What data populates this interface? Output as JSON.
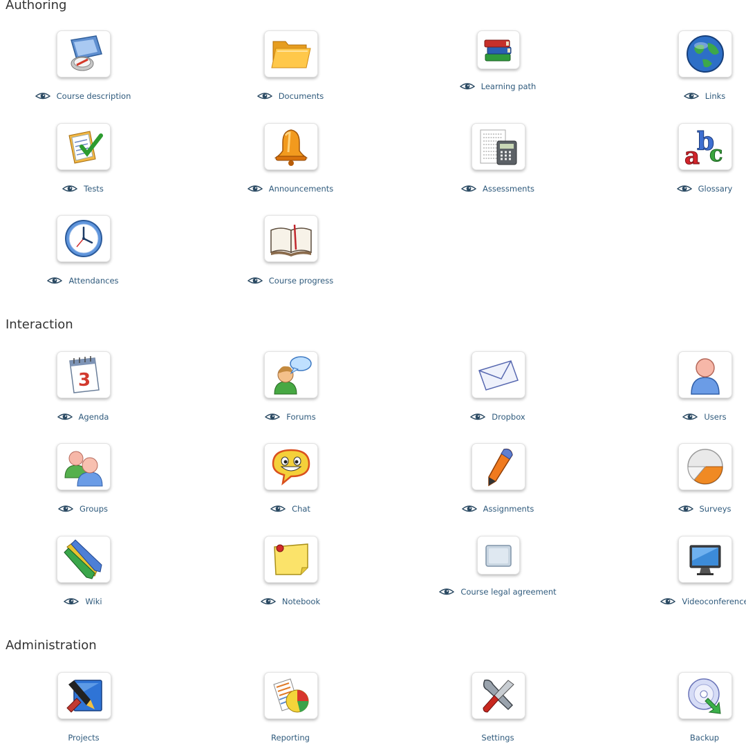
{
  "sections": {
    "authoring": {
      "title": "Authoring"
    },
    "interaction": {
      "title": "Interaction"
    },
    "administration": {
      "title": "Administration"
    }
  },
  "tools": {
    "course_description": {
      "label": "Course description",
      "icon": "compass-map-icon",
      "visible": true
    },
    "documents": {
      "label": "Documents",
      "icon": "folder-icon",
      "visible": true
    },
    "learning_path": {
      "label": "Learning path",
      "icon": "books-icon",
      "visible": true
    },
    "links": {
      "label": "Links",
      "icon": "globe-icon",
      "visible": true
    },
    "tests": {
      "label": "Tests",
      "icon": "checklist-icon",
      "visible": true
    },
    "announcements": {
      "label": "Announcements",
      "icon": "bell-icon",
      "visible": true
    },
    "assessments": {
      "label": "Assessments",
      "icon": "calculator-icon",
      "visible": true
    },
    "glossary": {
      "label": "Glossary",
      "icon": "abc-icon",
      "visible": true
    },
    "attendances": {
      "label": "Attendances",
      "icon": "clock-icon",
      "visible": true
    },
    "course_progress": {
      "label": "Course progress",
      "icon": "open-book-icon",
      "visible": true
    },
    "agenda": {
      "label": "Agenda",
      "icon": "calendar-icon",
      "visible": true
    },
    "forums": {
      "label": "Forums",
      "icon": "speech-user-icon",
      "visible": true
    },
    "dropbox": {
      "label": "Dropbox",
      "icon": "envelope-icon",
      "visible": true
    },
    "users": {
      "label": "Users",
      "icon": "user-icon",
      "visible": true
    },
    "groups": {
      "label": "Groups",
      "icon": "group-icon",
      "visible": true
    },
    "chat": {
      "label": "Chat",
      "icon": "smiley-chat-icon",
      "visible": true
    },
    "assignments": {
      "label": "Assignments",
      "icon": "pen-icon",
      "visible": true
    },
    "surveys": {
      "label": "Surveys",
      "icon": "pie-icon",
      "visible": true
    },
    "wiki": {
      "label": "Wiki",
      "icon": "pencils-icon",
      "visible": true
    },
    "notebook": {
      "label": "Notebook",
      "icon": "sticky-note-icon",
      "visible": true
    },
    "course_legal_agreement": {
      "label": "Course legal agreement",
      "icon": "legal-doc-icon",
      "visible": true
    },
    "videoconference": {
      "label": "Videoconference",
      "icon": "monitor-icon",
      "visible": true
    },
    "projects": {
      "label": "Projects",
      "icon": "blueprint-pen-icon"
    },
    "reporting": {
      "label": "Reporting",
      "icon": "report-chart-icon"
    },
    "settings": {
      "label": "Settings",
      "icon": "wrench-screwdriver-icon"
    },
    "backup": {
      "label": "Backup",
      "icon": "disc-arrow-icon"
    }
  },
  "colors": {
    "link": "#2f5a7c",
    "heading": "#333333",
    "tile_border": "#e3e3e3"
  }
}
